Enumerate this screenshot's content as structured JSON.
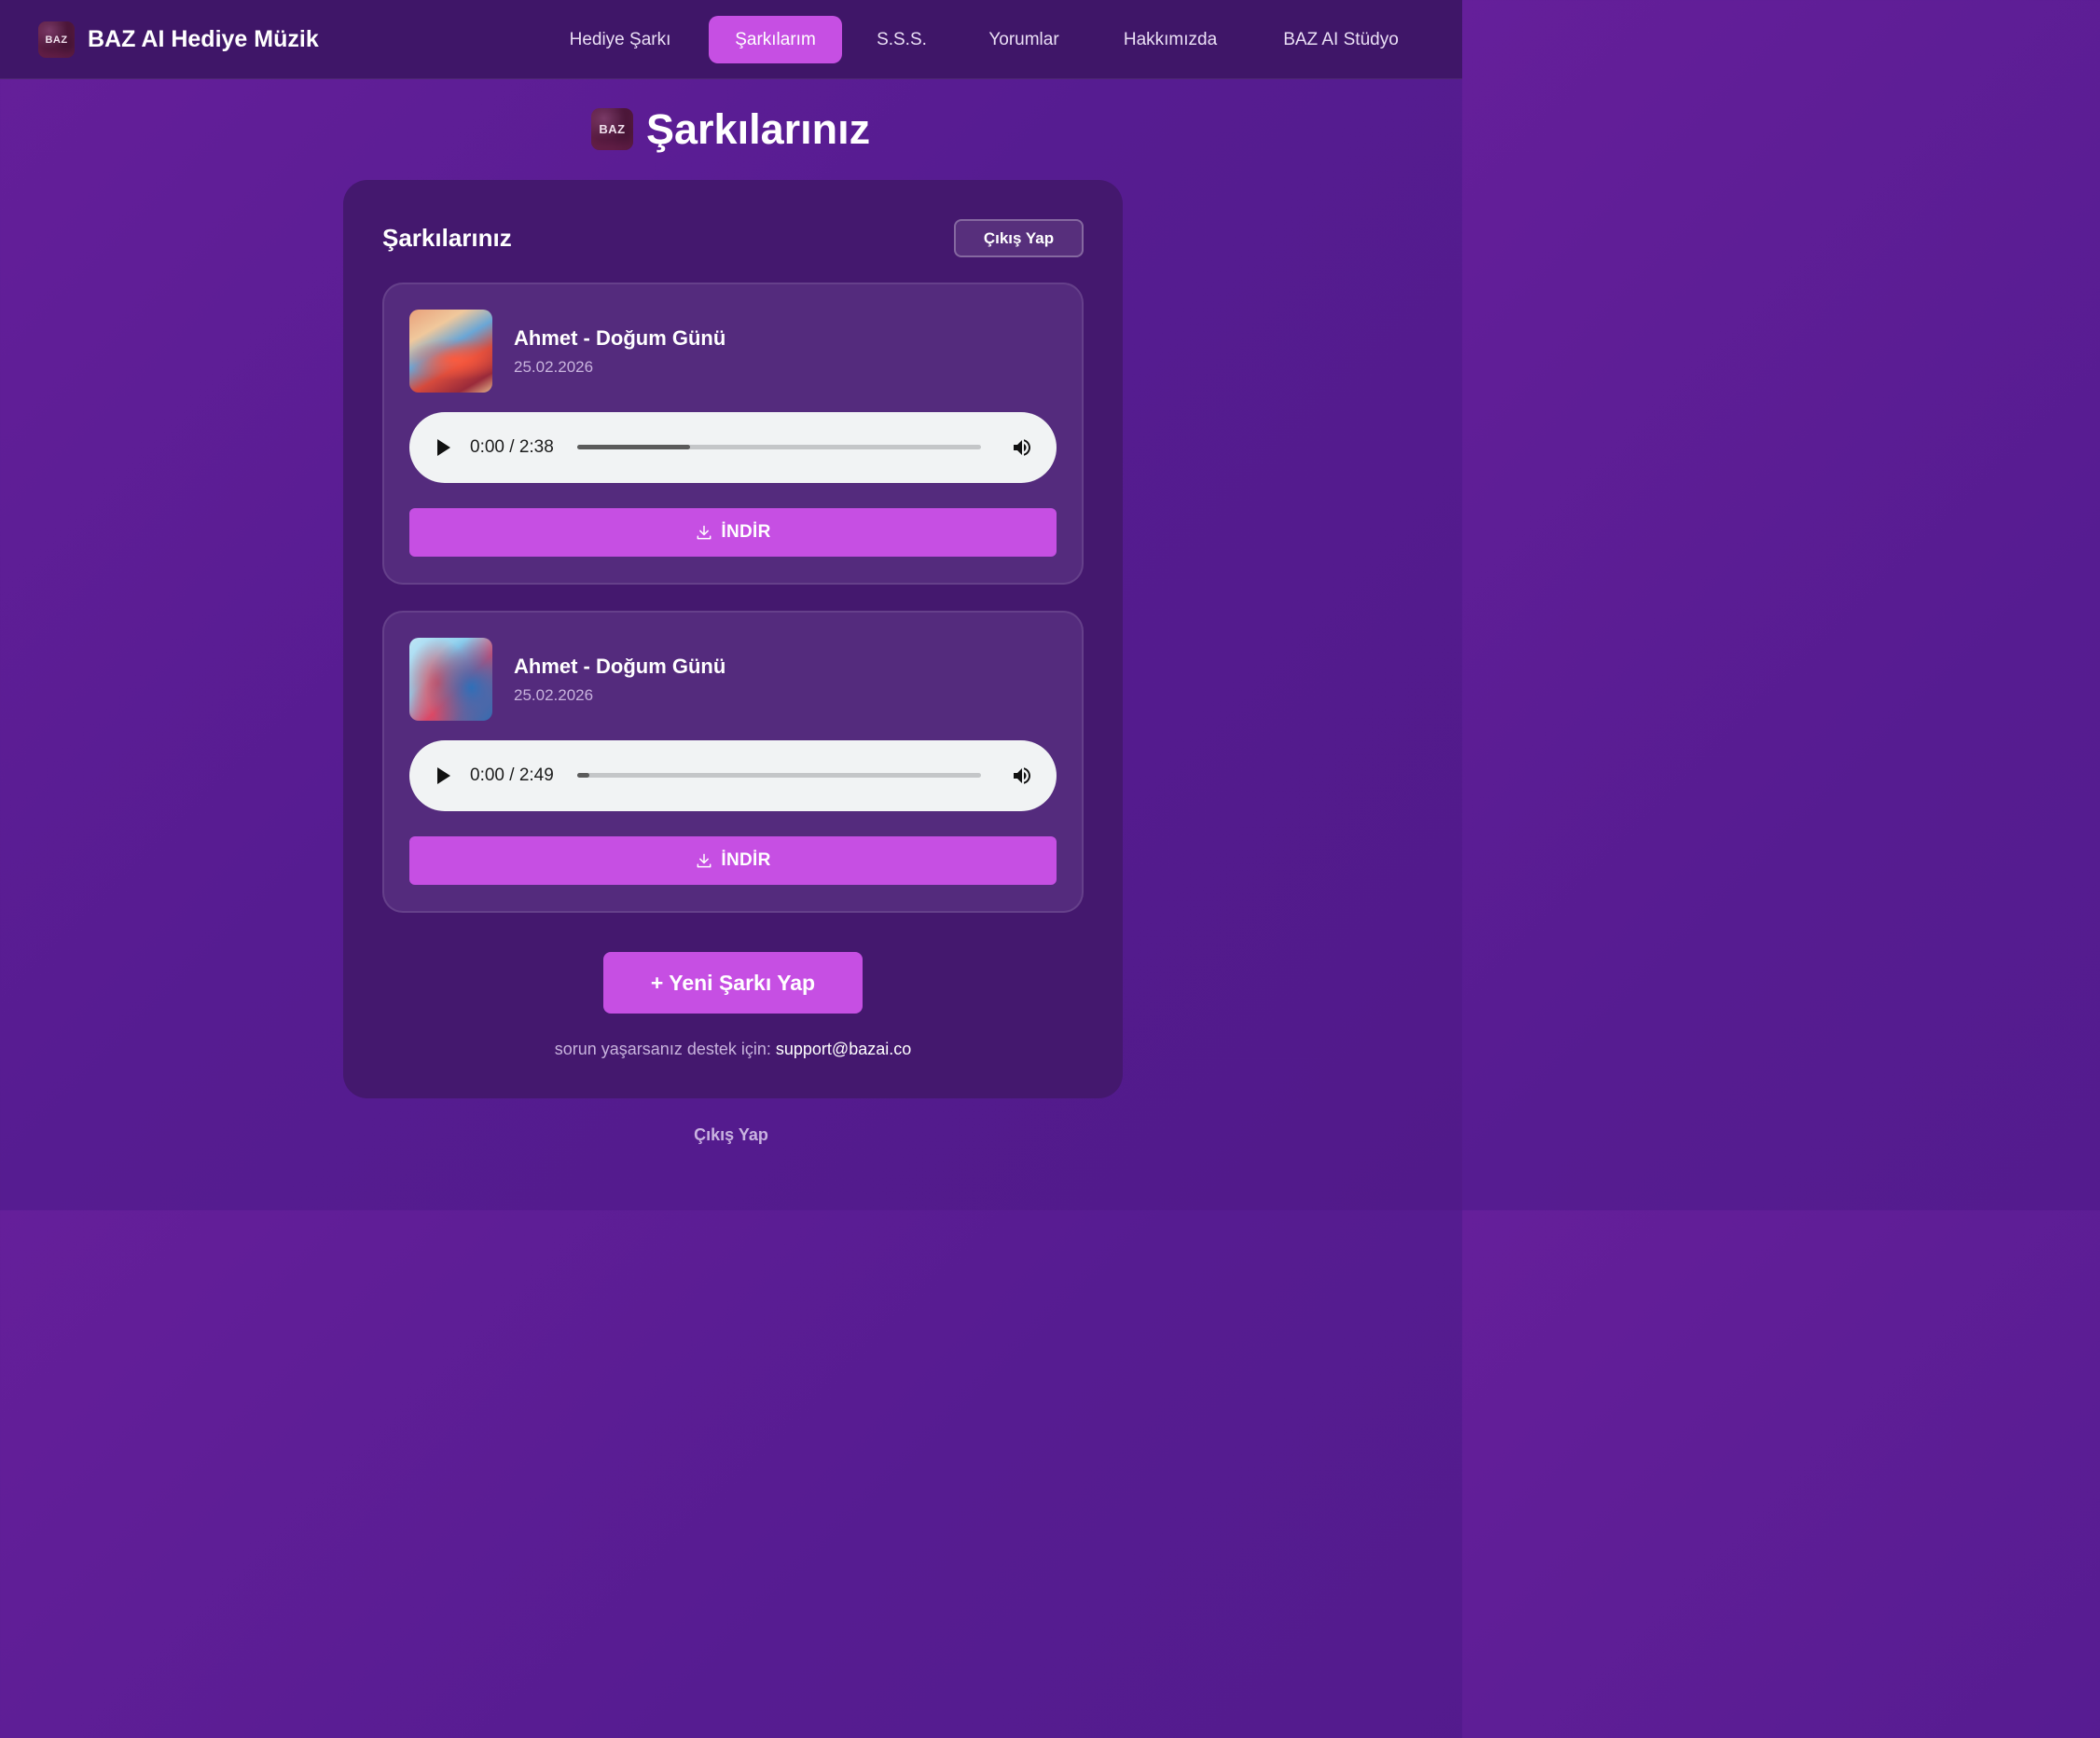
{
  "brand": {
    "logo_text": "BAZ",
    "title": "BAZ AI Hediye Müzik"
  },
  "nav": {
    "items": [
      {
        "label": "Hediye Şarkı",
        "active": false
      },
      {
        "label": "Şarkılarım",
        "active": true
      },
      {
        "label": "S.S.S.",
        "active": false
      },
      {
        "label": "Yorumlar",
        "active": false
      },
      {
        "label": "Hakkımızda",
        "active": false
      },
      {
        "label": "BAZ AI Stüdyo",
        "active": false
      }
    ]
  },
  "page": {
    "logo_text": "BAZ",
    "heading": "Şarkılarınız"
  },
  "card": {
    "title": "Şarkılarınız",
    "logout_label": "Çıkış Yap",
    "songs": [
      {
        "title": "Ahmet - Doğum Günü",
        "date": "25.02.2026",
        "time": "0:00 / 2:38",
        "progress_fraction": 0.28,
        "download_label": "İNDİR"
      },
      {
        "title": "Ahmet - Doğum Günü",
        "date": "25.02.2026",
        "time": "0:00 / 2:49",
        "progress_fraction": 0.03,
        "download_label": "İNDİR"
      }
    ],
    "new_song_label": "+ Yeni Şarkı Yap",
    "support_text": "sorun yaşarsanız destek için:",
    "support_email": "support@bazai.co"
  },
  "footer": {
    "logout_label": "Çıkış Yap"
  },
  "icons": {
    "play": "play-icon",
    "volume": "volume-icon",
    "download": "download-icon"
  },
  "colors": {
    "accent": "#c64fe3",
    "navbar": "#3f1668",
    "card": "#44186e",
    "song_card": "#542b7d"
  }
}
